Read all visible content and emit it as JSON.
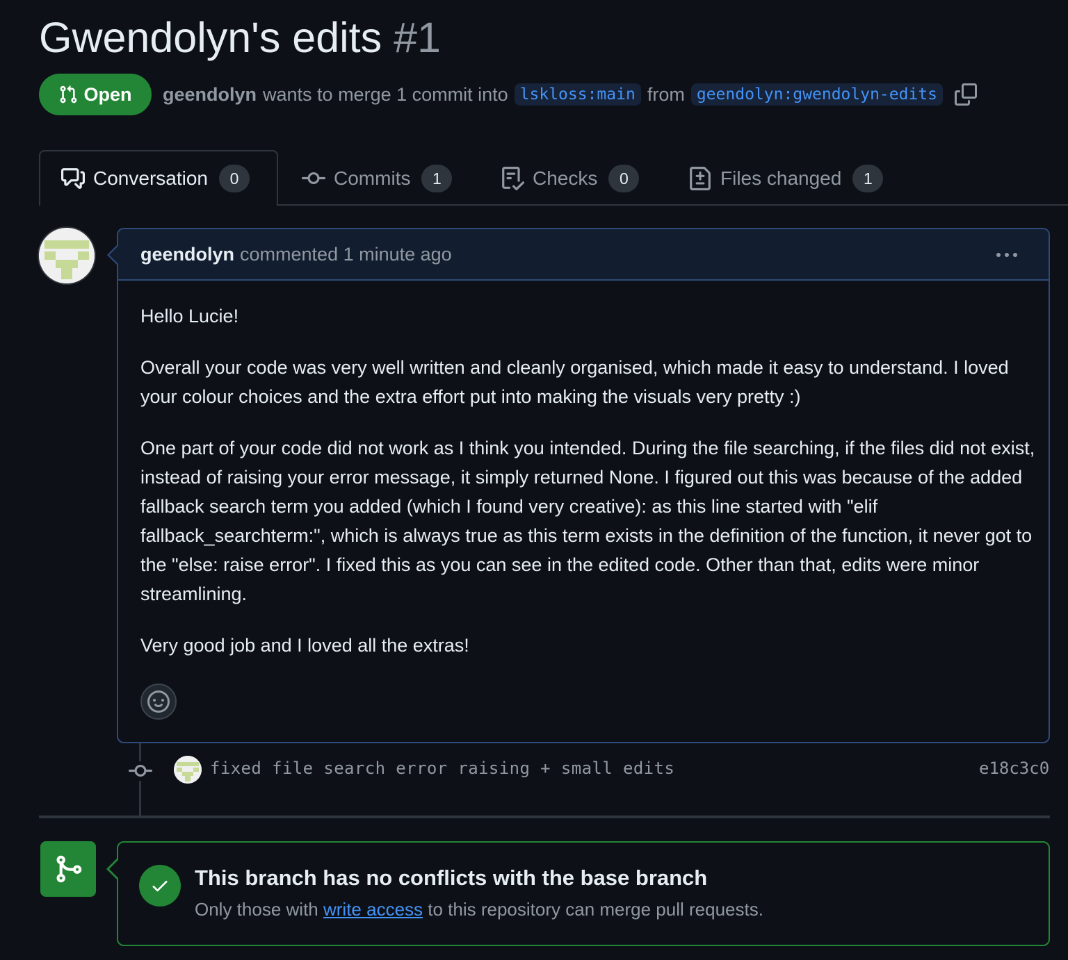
{
  "pr": {
    "title": "Gwendolyn's edits",
    "number": "#1",
    "state": "Open",
    "author": "geendolyn",
    "merge_text": "wants to merge 1 commit into",
    "base_branch": "lskloss:main",
    "from_text": "from",
    "head_branch": "geendolyn:gwendolyn-edits"
  },
  "tabs": [
    {
      "label": "Conversation",
      "count": "0",
      "icon": "comment-discussion-icon",
      "active": true
    },
    {
      "label": "Commits",
      "count": "1",
      "icon": "git-commit-icon"
    },
    {
      "label": "Checks",
      "count": "0",
      "icon": "checklist-icon"
    },
    {
      "label": "Files changed",
      "count": "1",
      "icon": "file-diff-icon"
    }
  ],
  "comment": {
    "author": "geendolyn",
    "meta": "commented 1 minute ago",
    "paragraphs": [
      "Hello Lucie!",
      "Overall your code was very well written and cleanly organised, which made it easy to understand. I loved your colour choices and the extra effort put into making the visuals very pretty :)",
      "One part of your code did not work as I think you intended. During the file searching, if the files did not exist, instead of raising your error message, it simply returned None. I figured out this was because of the added fallback search term you added (which I found very creative): as this line started with \"elif fallback_searchterm:\", which is always true as this term exists in the definition of the function, it never got to the \"else: raise error\". I fixed this as you can see in the edited code. Other than that, edits were minor streamlining.",
      "Very good job and I loved all the extras!"
    ]
  },
  "commit": {
    "message": "fixed file search error raising + small edits",
    "sha": "e18c3c0"
  },
  "merge": {
    "title": "This branch has no conflicts with the base branch",
    "sub_before": "Only those with",
    "sub_link": "write access",
    "sub_after": "to this repository can merge pull requests."
  },
  "colors": {
    "background": "#0d1117",
    "open_green": "#238636",
    "link_blue": "#4493f8",
    "muted": "#9198a1"
  }
}
